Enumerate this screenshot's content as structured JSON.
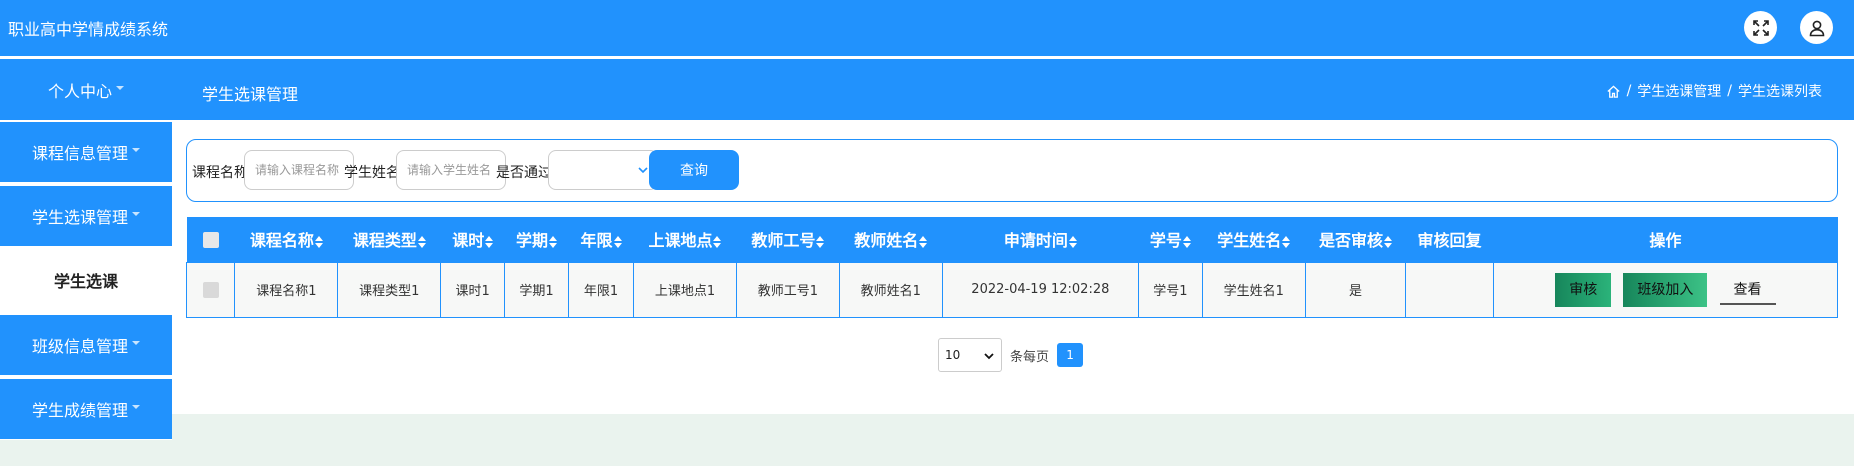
{
  "header": {
    "app_title": "职业高中学情成绩系统",
    "icons": [
      "fullscreen-icon",
      "user-icon"
    ]
  },
  "subbar": {
    "personal_center": "个人中心",
    "page_title": "学生选课管理",
    "breadcrumb": {
      "sep": "/",
      "level1": "学生选课管理",
      "level2": "学生选课列表"
    }
  },
  "sidebar": {
    "items": [
      {
        "label": "课程信息管理",
        "caret": true
      },
      {
        "label": "学生选课管理",
        "caret": true
      },
      {
        "label": "学生选课",
        "caret": false,
        "active": true
      },
      {
        "label": "班级信息管理",
        "caret": true
      },
      {
        "label": "学生成绩管理",
        "caret": true
      }
    ]
  },
  "search": {
    "course_name_label": "课程名称",
    "course_name_placeholder": "请输入课程名称",
    "course_name_value": "",
    "student_name_label": "学生姓名",
    "student_name_placeholder": "请输入学生姓名",
    "student_name_value": "",
    "passed_label": "是否通过",
    "passed_value": "",
    "query_label": "查询"
  },
  "table": {
    "columns": [
      "课程名称",
      "课程类型",
      "课时",
      "学期",
      "年限",
      "上课地点",
      "教师工号",
      "教师姓名",
      "申请时间",
      "学号",
      "学生姓名",
      "是否审核",
      "审核回复",
      "操作"
    ],
    "rows": [
      {
        "cells": [
          "课程名称1",
          "课程类型1",
          "课时1",
          "学期1",
          "年限1",
          "上课地点1",
          "教师工号1",
          "教师姓名1",
          "2022-04-19 12:02:28",
          "学号1",
          "学生姓名1",
          "是",
          ""
        ],
        "actions": {
          "audit": "审核",
          "join_class": "班级加入",
          "view": "查看"
        }
      }
    ]
  },
  "pagination": {
    "page_size": "10",
    "per_page_text": "条每页",
    "current_page": "1"
  },
  "colors": {
    "primary": "#2192fd",
    "green": "#1f9e69",
    "footer_bg": "#eaf3ee"
  }
}
